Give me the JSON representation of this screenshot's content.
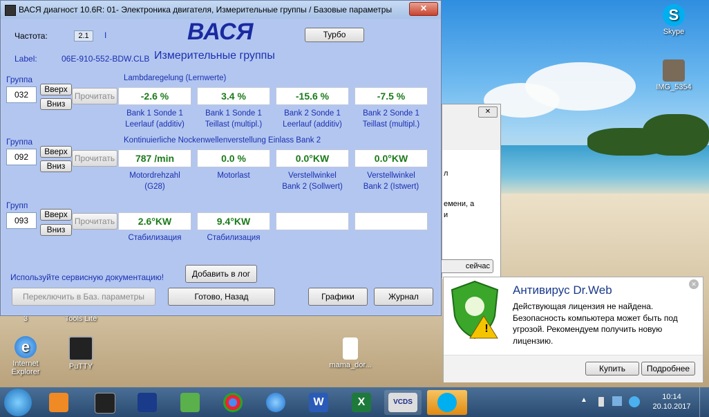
{
  "window": {
    "title": "ВАСЯ диагност 10.6R: 01- Электроника двигателя,  Измерительные группы / Базовые параметры",
    "close_glyph": "✕",
    "freq_label": "Частота:",
    "freq_value": "2.1",
    "freq_marker": "I",
    "logo": "ВАСЯ",
    "turbo_button": "Турбо",
    "label_label": "Label:",
    "label_value": "06E-910-552-BDW.CLB",
    "section_title": "Измерительные группы",
    "groups": [
      {
        "label": "Группа",
        "number": "032",
        "up": "Вверх",
        "down": "Вниз",
        "read": "Прочитать",
        "title": "Lambdaregelung (Lernwerte)",
        "values": [
          "-2.6 %",
          "3.4 %",
          "-15.6 %",
          "-7.5 %"
        ],
        "captions": [
          [
            "Bank 1 Sonde 1",
            "Leerlauf (additiv)"
          ],
          [
            "Bank 1 Sonde 1",
            "Teillast (multipl.)"
          ],
          [
            "Bank 2 Sonde 1",
            "Leerlauf (additiv)"
          ],
          [
            "Bank 2 Sonde 1",
            "Teillast (multipl.)"
          ]
        ]
      },
      {
        "label": "Группа",
        "number": "092",
        "up": "Вверх",
        "down": "Вниз",
        "read": "Прочитать",
        "title": "Kontinuierliche Nockenwellenverstellung Einlass Bank 2",
        "values": [
          "787 /min",
          "0.0 %",
          "0.0°KW",
          "0.0°KW"
        ],
        "captions": [
          [
            "Motordrehzahl",
            "(G28)"
          ],
          [
            "Motorlast",
            ""
          ],
          [
            "Verstellwinkel",
            "Bank 2 (Sollwert)"
          ],
          [
            "Verstellwinkel",
            "Bank 2 (Istwert)"
          ]
        ]
      },
      {
        "label": "Групп",
        "number": "093",
        "up": "Вверх",
        "down": "Вниз",
        "read": "Прочитать",
        "title": "",
        "values": [
          "2.6°KW",
          "9.4°KW",
          "",
          ""
        ],
        "captions": [
          [
            "Стабилизация",
            ""
          ],
          [
            "Стабилизация",
            ""
          ],
          [
            "",
            ""
          ],
          [
            "",
            ""
          ]
        ]
      }
    ],
    "service_doc": "Используйте сервисную документацию!",
    "add_log": "Добавить в лог",
    "switch_basic": "Переключить в Баз. параметры",
    "done_back": "Готово, Назад",
    "graphs": "Графики",
    "journal": "Журнал"
  },
  "desktop_icons": [
    {
      "label": "Skype",
      "icon": "skype-icon"
    },
    {
      "label": "IMG_5354",
      "icon": "image-file-icon"
    },
    {
      "label": "Internet Explorer",
      "icon": "internet-explorer-icon"
    },
    {
      "label": "PuTTY",
      "icon": "putty-icon"
    },
    {
      "label": "mama_dor...",
      "icon": "mp3-file-icon"
    },
    {
      "label": "3",
      "icon": ""
    },
    {
      "label": "Tools Lite",
      "icon": ""
    }
  ],
  "bg_window": {
    "line1": "л",
    "line2": "емени, а",
    "line3": "и",
    "button": "сейчас"
  },
  "drweb": {
    "title": "Антивирус Dr.Web",
    "text": "Действующая лицензия не найдена. Безопасность компьютера может быть под угрозой. Рекомендуем получить новую лицензию.",
    "buy": "Купить",
    "more": "Подробнее",
    "close_glyph": "✕",
    "warning_glyph": "!"
  },
  "taskbar": {
    "time": "10:14",
    "date": "20.10.2017",
    "apps": [
      "start-button",
      "media-player-icon",
      "terminal-icon",
      "file-manager-icon",
      "network-icon",
      "chrome-icon",
      "internet-explorer-icon",
      "word-icon",
      "excel-icon",
      "vcds-icon",
      "skype-icon"
    ],
    "vcds_label": "VCDS",
    "word_glyph": "W",
    "excel_glyph": "X",
    "tray_arrow": "▲"
  }
}
